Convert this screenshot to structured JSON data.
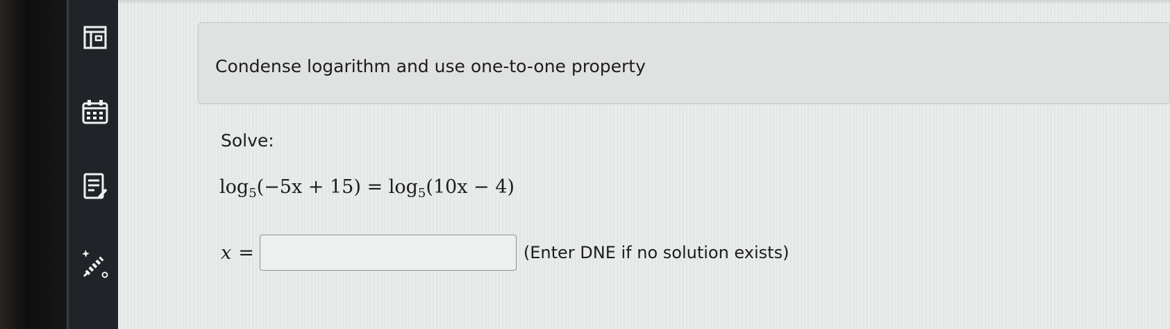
{
  "sidebar": {
    "items": [
      {
        "icon": "layout-icon"
      },
      {
        "icon": "calendar-icon"
      },
      {
        "icon": "assignment-icon"
      },
      {
        "icon": "magic-pencil-icon"
      }
    ]
  },
  "question": {
    "title": "Condense logarithm and use one-to-one property",
    "prompt": "Solve:",
    "equation": {
      "lhs_func": "log",
      "lhs_base": "5",
      "lhs_arg": "(−5x + 15)",
      "equals": "=",
      "rhs_func": "log",
      "rhs_base": "5",
      "rhs_arg": "(10x − 4)"
    },
    "answer": {
      "variable": "x",
      "equals": "=",
      "value": "",
      "placeholder": "",
      "hint": "(Enter DNE if no solution exists)"
    }
  }
}
